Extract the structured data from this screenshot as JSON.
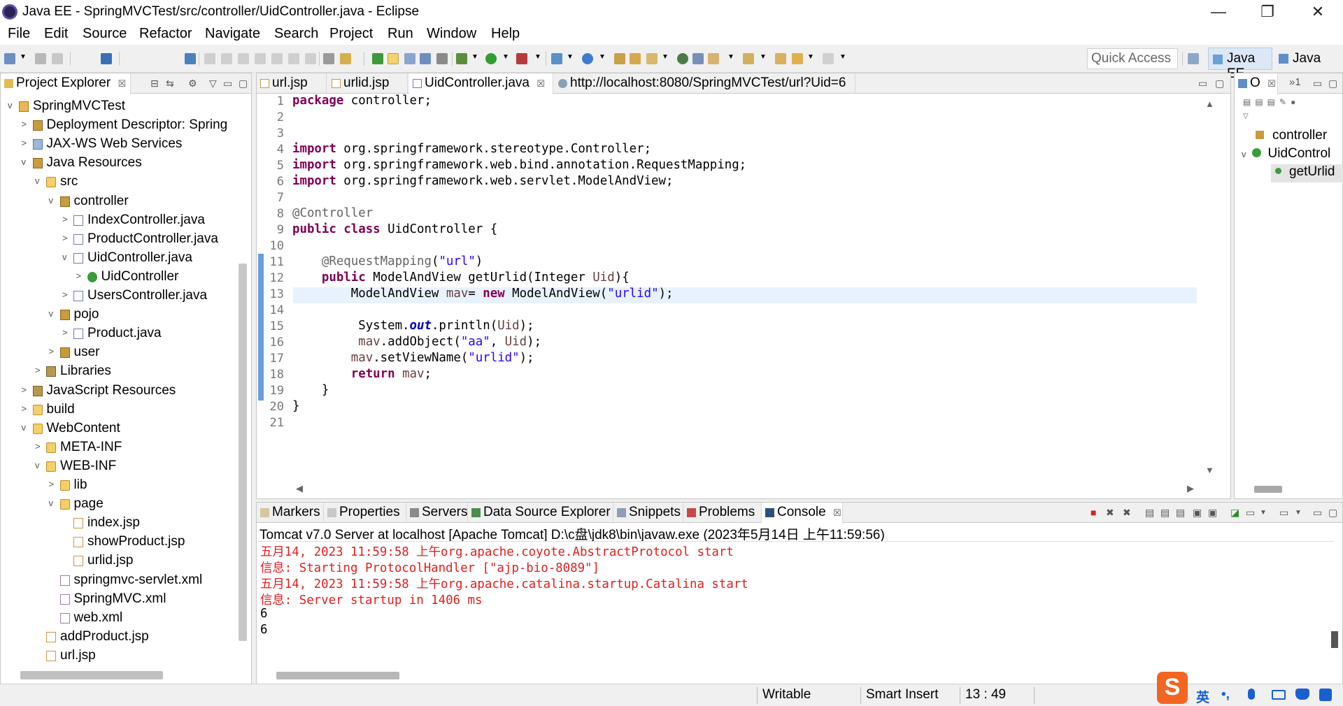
{
  "window": {
    "title": "Java EE - SpringMVCTest/src/controller/UidController.java - Eclipse",
    "minimize": "—",
    "maximize": "❐",
    "close": "✕"
  },
  "menu": [
    "File",
    "Edit",
    "Source",
    "Refactor",
    "Navigate",
    "Search",
    "Project",
    "Run",
    "Window",
    "Help"
  ],
  "toolbar": {
    "quick_access": "Quick Access",
    "perspectives": [
      "Java EE",
      "Java"
    ]
  },
  "project_explorer": {
    "tab_label": "Project Explorer",
    "tree": [
      {
        "label": "SpringMVCTest",
        "depth": 0,
        "arrow": "v",
        "icon": "project-icon"
      },
      {
        "label": "Deployment Descriptor: Spring",
        "depth": 1,
        "arrow": ">",
        "icon": "descriptor-icon"
      },
      {
        "label": "JAX-WS Web Services",
        "depth": 1,
        "arrow": ">",
        "icon": "webservice-icon"
      },
      {
        "label": "Java Resources",
        "depth": 1,
        "arrow": "v",
        "icon": "java-resources-icon"
      },
      {
        "label": "src",
        "depth": 2,
        "arrow": "v",
        "icon": "source-folder-icon"
      },
      {
        "label": "controller",
        "depth": 3,
        "arrow": "v",
        "icon": "package-icon"
      },
      {
        "label": "IndexController.java",
        "depth": 4,
        "arrow": ">",
        "icon": "java-file-icon"
      },
      {
        "label": "ProductController.java",
        "depth": 4,
        "arrow": ">",
        "icon": "java-file-icon"
      },
      {
        "label": "UidController.java",
        "depth": 4,
        "arrow": "v",
        "icon": "java-file-icon"
      },
      {
        "label": "UidController",
        "depth": 5,
        "arrow": ">",
        "icon": "class-icon"
      },
      {
        "label": "UsersController.java",
        "depth": 4,
        "arrow": ">",
        "icon": "java-file-icon"
      },
      {
        "label": "pojo",
        "depth": 3,
        "arrow": "v",
        "icon": "package-icon"
      },
      {
        "label": "Product.java",
        "depth": 4,
        "arrow": ">",
        "icon": "java-file-icon"
      },
      {
        "label": "user",
        "depth": 3,
        "arrow": ">",
        "icon": "package-icon"
      },
      {
        "label": "Libraries",
        "depth": 2,
        "arrow": ">",
        "icon": "library-icon"
      },
      {
        "label": "JavaScript Resources",
        "depth": 1,
        "arrow": ">",
        "icon": "js-resources-icon"
      },
      {
        "label": "build",
        "depth": 1,
        "arrow": ">",
        "icon": "folder-icon"
      },
      {
        "label": "WebContent",
        "depth": 1,
        "arrow": "v",
        "icon": "folder-icon"
      },
      {
        "label": "META-INF",
        "depth": 2,
        "arrow": ">",
        "icon": "folder-icon"
      },
      {
        "label": "WEB-INF",
        "depth": 2,
        "arrow": "v",
        "icon": "folder-icon"
      },
      {
        "label": "lib",
        "depth": 3,
        "arrow": ">",
        "icon": "folder-icon"
      },
      {
        "label": "page",
        "depth": 3,
        "arrow": "v",
        "icon": "folder-icon"
      },
      {
        "label": "index.jsp",
        "depth": 4,
        "arrow": "",
        "icon": "jsp-file-icon"
      },
      {
        "label": "showProduct.jsp",
        "depth": 4,
        "arrow": "",
        "icon": "jsp-file-icon"
      },
      {
        "label": "urlid.jsp",
        "depth": 4,
        "arrow": "",
        "icon": "jsp-file-icon"
      },
      {
        "label": "springmvc-servlet.xml",
        "depth": 3,
        "arrow": "",
        "icon": "xml-file-icon"
      },
      {
        "label": "SpringMVC.xml",
        "depth": 3,
        "arrow": "",
        "icon": "xml-file-icon"
      },
      {
        "label": "web.xml",
        "depth": 3,
        "arrow": "",
        "icon": "xml-file-icon"
      },
      {
        "label": "addProduct.jsp",
        "depth": 2,
        "arrow": "",
        "icon": "jsp-file-icon"
      },
      {
        "label": "url.jsp",
        "depth": 2,
        "arrow": "",
        "icon": "jsp-file-icon"
      }
    ]
  },
  "editor": {
    "tabs": [
      {
        "label": "url.jsp",
        "active": false
      },
      {
        "label": "urlid.jsp",
        "active": false
      },
      {
        "label": "UidController.java",
        "active": true
      },
      {
        "label": "http://localhost:8080/SpringMVCTest/url?Uid=6",
        "active": false
      }
    ],
    "line_numbers": [
      "1",
      "2",
      "3",
      "4",
      "5",
      "6",
      "7",
      "8",
      "9",
      "10",
      "11",
      "12",
      "13",
      "14",
      "15",
      "16",
      "17",
      "18",
      "19",
      "20",
      "21"
    ],
    "current_line": 13
  },
  "outline": {
    "tab_label": "O",
    "overflow": "»1",
    "items": [
      "controller",
      "UidControl",
      "getUrlid"
    ]
  },
  "bottom_panel": {
    "tabs": [
      "Markers",
      "Properties",
      "Servers",
      "Data Source Explorer",
      "Snippets",
      "Problems",
      "Console"
    ],
    "active_tab": "Console",
    "console_header": "Tomcat v7.0 Server at localhost [Apache Tomcat] D:\\c盘\\jdk8\\bin\\javaw.exe (2023年5月14日 上午11:59:56)",
    "console_lines": [
      {
        "text": "五月14, 2023 11:59:58 上午org.apache.coyote.AbstractProtocol start",
        "color": "red"
      },
      {
        "text": "信息: Starting ProtocolHandler [\"ajp-bio-8089\"]",
        "color": "red"
      },
      {
        "text": "五月14, 2023 11:59:58 上午org.apache.catalina.startup.Catalina start",
        "color": "red"
      },
      {
        "text": "信息: Server startup in 1406 ms",
        "color": "red"
      },
      {
        "text": "6",
        "color": "black"
      },
      {
        "text": "6",
        "color": "black"
      }
    ]
  },
  "status": {
    "mode": "Writable",
    "insert": "Smart Insert",
    "position": "13 : 49",
    "ime_lang": "英",
    "ime_punct": "•,",
    "ime_brand": "S"
  },
  "colors": {
    "console_red": "#e02020",
    "keyword": "#7f0055",
    "string": "#2a00ff",
    "current_line_bg": "#e8f2fe",
    "active_perspective": "#dce8f5"
  }
}
